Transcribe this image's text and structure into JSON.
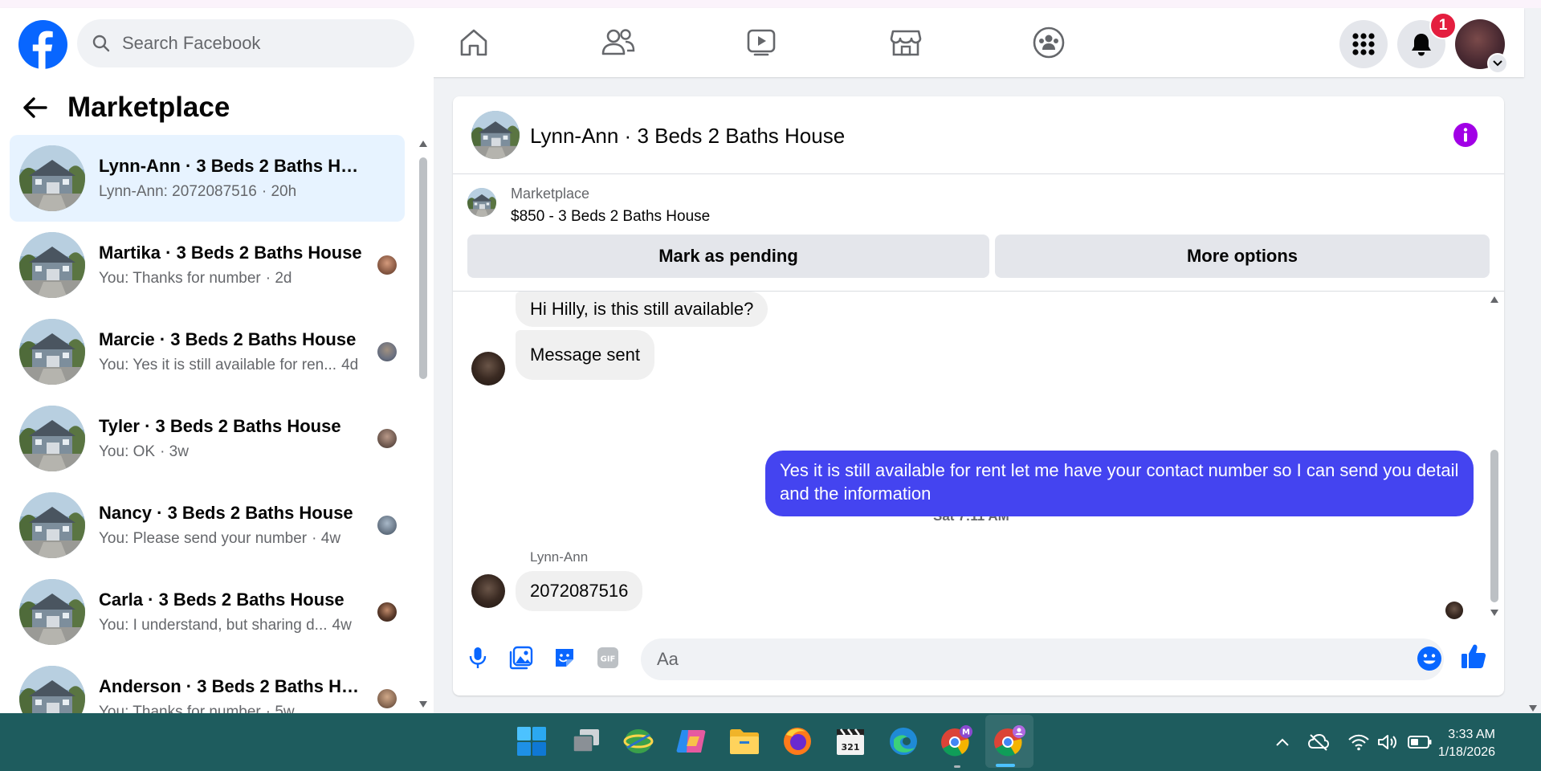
{
  "header": {
    "search_placeholder": "Search Facebook",
    "notification_count": "1"
  },
  "left_panel": {
    "title": "Marketplace",
    "conversations": [
      {
        "title": "Lynn-Ann · 3 Beds 2 Baths House",
        "snippet": "Lynn-Ann: 2072087516",
        "time": "· 20h",
        "active": true
      },
      {
        "title": "Martika · 3 Beds 2 Baths House",
        "snippet": "You: Thanks for number",
        "time": "· 2d"
      },
      {
        "title": "Marcie · 3 Beds 2 Baths House",
        "snippet": "You: Yes it is still available for ren...",
        "time": "4d"
      },
      {
        "title": "Tyler · 3 Beds 2 Baths House",
        "snippet": "You: OK",
        "time": "· 3w"
      },
      {
        "title": "Nancy · 3 Beds 2 Baths House",
        "snippet": "You: Please send your number",
        "time": "· 4w"
      },
      {
        "title": "Carla · 3 Beds 2 Baths House",
        "snippet": "You: I understand, but sharing d...",
        "time": "4w"
      },
      {
        "title": "Anderson · 3 Beds 2 Baths Ho...",
        "snippet": "You: Thanks for number",
        "time": "· 5w"
      }
    ]
  },
  "chat": {
    "title": "Lynn-Ann · 3 Beds 2 Baths House",
    "listing": {
      "category": "Marketplace",
      "price_title": "$850 - 3 Beds 2 Baths House",
      "mark_pending_label": "Mark as pending",
      "more_options_label": "More options"
    },
    "messages": {
      "incoming_1": "Hi Hilly, is this still available?",
      "incoming_2": "Message sent",
      "timestamp": "Sat 7:11 AM",
      "outgoing_1": "Yes it is still available for rent let me have your contact number so I can send you detail and the information",
      "sender_name": "Lynn-Ann",
      "incoming_3": "2072087516"
    },
    "composer_placeholder": "Aa"
  },
  "taskbar": {
    "time": "3:33 AM",
    "date": "1/18/2026"
  },
  "colors": {
    "facebook_blue": "#0866ff",
    "outgoing_bubble": "#4444f0",
    "info_purple": "#a100e6",
    "taskbar": "#1e5c5e"
  }
}
